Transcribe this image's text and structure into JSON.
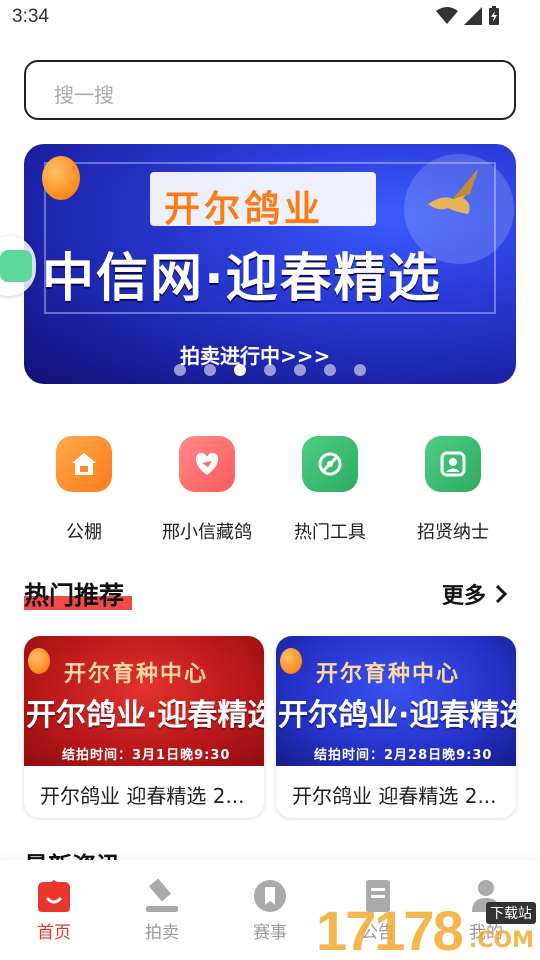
{
  "status": {
    "time": "3:34"
  },
  "search": {
    "placeholder": "搜一搜"
  },
  "banner": {
    "line1": "开尔鸽业",
    "line2": "中信网·迎春精选",
    "line3": "拍卖进行中>>>",
    "page_count": 7,
    "active_index": 2
  },
  "quick_links": [
    {
      "label": "公棚",
      "icon": "home-icon",
      "color": "#ff8a2a"
    },
    {
      "label": "邢小信藏鸽",
      "icon": "pigeon-heart-icon",
      "color": "#ff6b6b"
    },
    {
      "label": "热门工具",
      "icon": "tools-icon",
      "color": "#3cb46e"
    },
    {
      "label": "招贤纳士",
      "icon": "person-search-icon",
      "color": "#3cb46e"
    }
  ],
  "hot": {
    "title": "热门推荐",
    "more_label": "更多",
    "cards": [
      {
        "img_title": "开尔育种中心",
        "img_sub": "开尔鸽业·迎春精选",
        "img_time": "结拍时间：3月1日晚9:30",
        "caption": "开尔鸽业 迎春精选 2...",
        "theme": "red"
      },
      {
        "img_title": "开尔育种中心",
        "img_sub": "开尔鸽业·迎春精选",
        "img_time": "结拍时间：2月28日晚9:30",
        "caption": "开尔鸽业 迎春精选 2...",
        "theme": "blue"
      }
    ]
  },
  "news": {
    "title": "最新资讯"
  },
  "tabs": [
    {
      "label": "首页",
      "icon": "home-tab-icon",
      "active": true
    },
    {
      "label": "拍卖",
      "icon": "gavel-icon",
      "active": false
    },
    {
      "label": "赛事",
      "icon": "medal-icon",
      "active": false
    },
    {
      "label": "公告",
      "icon": "notice-icon",
      "active": false
    },
    {
      "label": "我的",
      "icon": "profile-icon",
      "active": false
    }
  ],
  "watermark": {
    "text": "17178",
    "badge": "下载站",
    "domain": ".COM"
  },
  "colors": {
    "accent": "#e8362c",
    "inactive": "#999999"
  }
}
